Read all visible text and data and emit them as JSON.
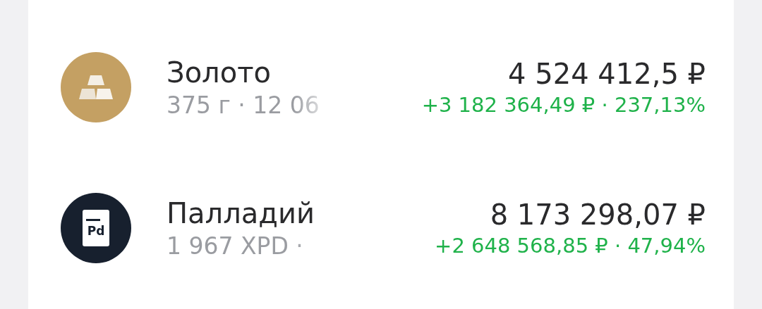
{
  "assets": [
    {
      "kind": "gold",
      "name": "Золото",
      "details": "375 г · 12 06",
      "value": "4 524 412,5 ₽",
      "change": "+3 182 364,49 ₽ · 237,13%"
    },
    {
      "kind": "palladium",
      "icon_label": "Pd",
      "name": "Палладий",
      "details": "1 967 XPD ·",
      "value": "8 173 298,07 ₽",
      "change": "+2 648 568,85 ₽ · 47,94%"
    }
  ]
}
